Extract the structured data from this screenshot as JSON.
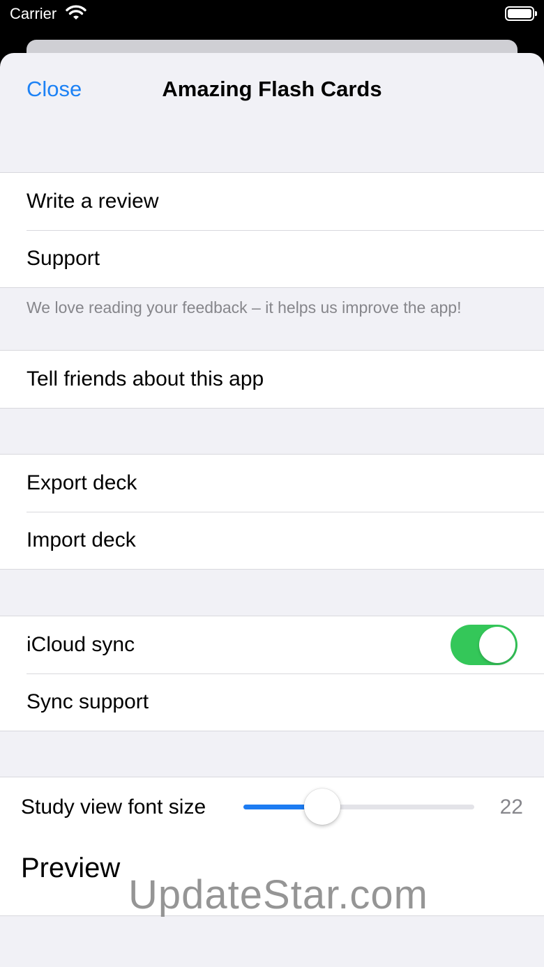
{
  "status_bar": {
    "carrier": "Carrier",
    "icons": [
      "wifi-icon",
      "battery-icon"
    ]
  },
  "nav": {
    "close_label": "Close",
    "title": "Amazing Flash Cards"
  },
  "feedback_group": {
    "items": [
      {
        "label": "Write a review"
      },
      {
        "label": "Support"
      }
    ],
    "footer": "We love reading your feedback – it helps us improve the app!"
  },
  "share_group": {
    "items": [
      {
        "label": "Tell friends about this app"
      }
    ]
  },
  "deck_group": {
    "items": [
      {
        "label": "Export deck"
      },
      {
        "label": "Import deck"
      }
    ]
  },
  "sync_group": {
    "items": [
      {
        "label": "iCloud sync",
        "toggle_on": true
      },
      {
        "label": "Sync support"
      }
    ]
  },
  "font_group": {
    "label": "Study view font size",
    "value": "22",
    "slider_fraction": 0.34,
    "preview": "Preview"
  },
  "watermark": "UpdateStar.com",
  "colors": {
    "accent": "#1d82f5",
    "toggle_on": "#34c759",
    "background": "#f1f1f6"
  }
}
